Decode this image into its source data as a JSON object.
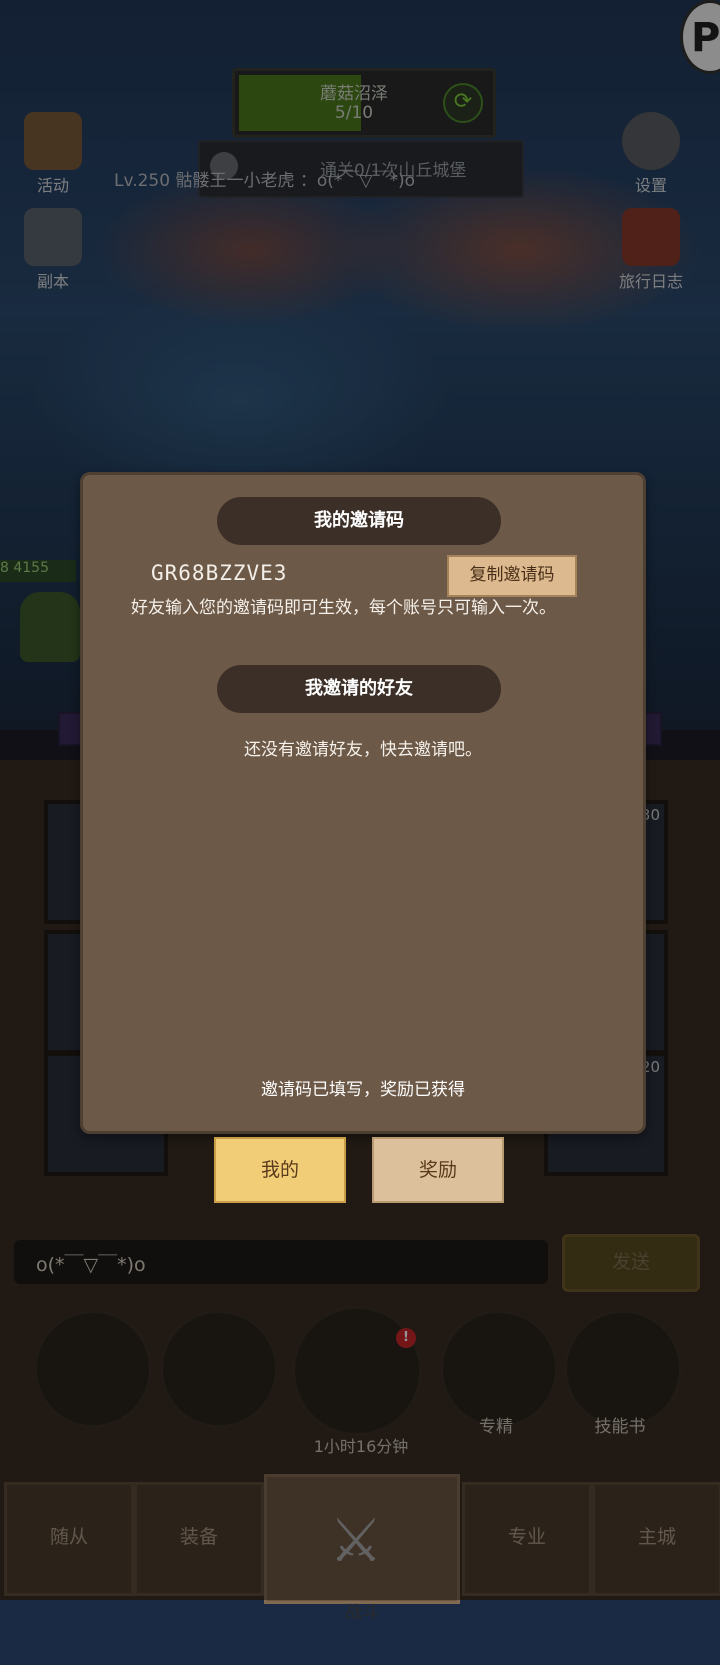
{
  "top": {
    "area_name": "蘑菇沼泽",
    "area_progress": "5/10",
    "area_progress_fraction": 0.5,
    "quest": "通关0/1次山丘城堡",
    "chat_preview": "Lv.250 骷髅王一小老虎 ：o(*￣▽￣*)o"
  },
  "side_left": [
    {
      "label": "活动"
    },
    {
      "label": "副本"
    }
  ],
  "side_right": [
    {
      "label": "设置"
    },
    {
      "label": "旅行日志"
    }
  ],
  "hero": {
    "level_text": "8 4155"
  },
  "grid_counts": [
    "30",
    "20"
  ],
  "dialog": {
    "invite_code_title": "我的邀请码",
    "invite_code": "GR68BZZVE3",
    "copy_button": "复制邀请码",
    "description": "好友输入您的邀请码即可生效，每个账号只可输入一次。",
    "friends_title": "我邀请的好友",
    "empty_message": "还没有邀请好友，快去邀请吧。",
    "footer_message": "邀请码已填写，奖励已获得"
  },
  "tabs": [
    {
      "label": "我的",
      "active": true
    },
    {
      "label": "奖励",
      "active": false
    }
  ],
  "chat": {
    "input_value": "o(*￣▽￣*)o",
    "send_label": "发送"
  },
  "actions": {
    "chest_timer": "1小时16分钟",
    "chest_alert": "!",
    "mastery_label": "专精",
    "skillbook_label": "技能书"
  },
  "nav": {
    "followers": "随从",
    "equipment": "装备",
    "battle": "战斗",
    "profession": "专业",
    "main_city": "主城"
  },
  "badge": {
    "letter": "P"
  },
  "colors": {
    "dialog_bg": "#6d5948",
    "banner_bg": "#3b2f27",
    "tab_active": "#f2cd78",
    "tab_inactive": "#dcc09c",
    "alert": "#c8262a"
  }
}
